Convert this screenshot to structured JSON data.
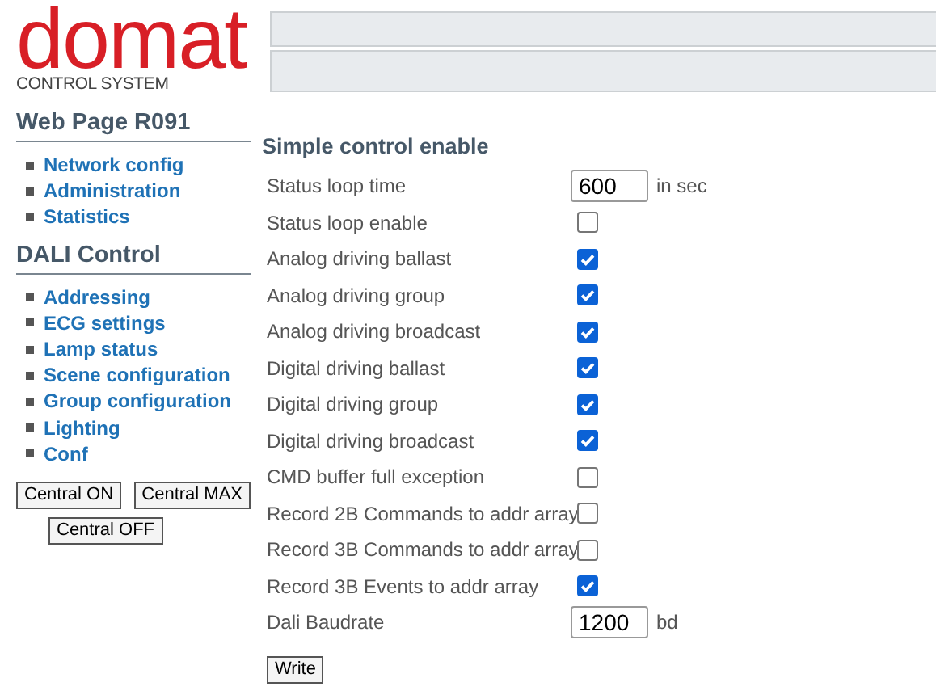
{
  "logo": {
    "brand": "domat",
    "tagline": "CONTROL SYSTEM"
  },
  "sidebar": {
    "sections": [
      {
        "heading": "Web Page R091",
        "links": [
          "Network config",
          "Administration",
          "Statistics"
        ]
      },
      {
        "heading": "DALI Control",
        "links": [
          "Addressing",
          "ECG settings",
          "Lamp status",
          "Scene configuration",
          "Group configuration",
          "Lighting",
          "Conf"
        ]
      }
    ],
    "buttons": [
      "Central ON",
      "Central MAX",
      "Central OFF"
    ]
  },
  "form": {
    "title": "Simple control enable",
    "rows": [
      {
        "kind": "number",
        "label": "Status loop time",
        "value": "600",
        "unit": "in sec"
      },
      {
        "kind": "checkbox",
        "label": "Status loop enable",
        "checked": false
      },
      {
        "kind": "checkbox",
        "label": "Analog driving ballast",
        "checked": true
      },
      {
        "kind": "checkbox",
        "label": "Analog driving group",
        "checked": true
      },
      {
        "kind": "checkbox",
        "label": "Analog driving broadcast",
        "checked": true
      },
      {
        "kind": "checkbox",
        "label": "Digital driving ballast",
        "checked": true
      },
      {
        "kind": "checkbox",
        "label": "Digital driving group",
        "checked": true
      },
      {
        "kind": "checkbox",
        "label": "Digital driving broadcast",
        "checked": true
      },
      {
        "kind": "checkbox",
        "label": "CMD buffer full exception",
        "checked": false
      },
      {
        "kind": "checkbox",
        "label": "Record 2B Commands to addr array",
        "checked": false
      },
      {
        "kind": "checkbox",
        "label": "Record 3B Commands to addr array",
        "checked": false
      },
      {
        "kind": "checkbox",
        "label": "Record 3B Events to addr array",
        "checked": true
      },
      {
        "kind": "number",
        "label": "Dali Baudrate",
        "value": "1200",
        "unit": "bd"
      }
    ],
    "submit": "Write"
  }
}
